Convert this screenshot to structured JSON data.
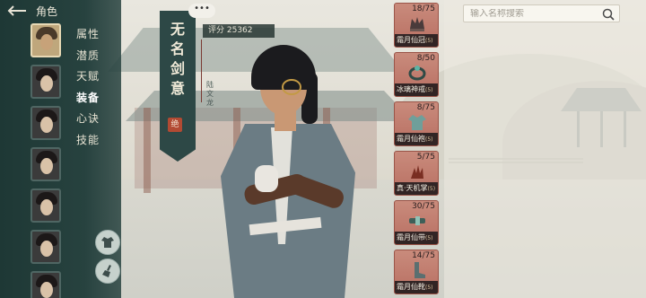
{
  "header": {
    "title": "角色"
  },
  "sidebar": {
    "portraits": [
      {
        "id": "hero-1",
        "active": true
      },
      {
        "id": "hero-2",
        "active": false
      },
      {
        "id": "hero-3",
        "active": false
      },
      {
        "id": "hero-4",
        "active": false
      },
      {
        "id": "hero-5",
        "active": false
      },
      {
        "id": "hero-6",
        "active": false
      },
      {
        "id": "hero-7",
        "active": false
      }
    ],
    "menu": [
      {
        "label": "属性",
        "active": false
      },
      {
        "label": "潜质",
        "active": false
      },
      {
        "label": "天赋",
        "active": false
      },
      {
        "label": "装备",
        "active": true
      },
      {
        "label": "心诀",
        "active": false
      },
      {
        "label": "技能",
        "active": false
      }
    ],
    "buttons": [
      {
        "icon": "robe-icon"
      },
      {
        "icon": "broom-icon"
      }
    ]
  },
  "banner": {
    "title_chars": [
      "无",
      "名",
      "剑",
      "意"
    ],
    "seal": "绝",
    "subtitle": "陆文龙"
  },
  "chat": {
    "label": "•••"
  },
  "score": {
    "label": "评分",
    "value": "25362",
    "text": "评分 25362"
  },
  "equipment": [
    {
      "count": "18/75",
      "name": "霜月仙冠",
      "grade": "(5)",
      "icon": "crown-icon"
    },
    {
      "count": "8/50",
      "name": "冰璃神戒",
      "grade": "(5)",
      "icon": "ring-icon"
    },
    {
      "count": "8/75",
      "name": "霜月仙袍",
      "grade": "(5)",
      "icon": "robe-icon"
    },
    {
      "count": "5/75",
      "name": "真·天机掌",
      "grade": "(5)",
      "icon": "claw-icon"
    },
    {
      "count": "30/75",
      "name": "霜月仙带",
      "grade": "(5)",
      "icon": "belt-icon"
    },
    {
      "count": "14/75",
      "name": "霜月仙靴",
      "grade": "(5)",
      "icon": "boots-icon"
    }
  ],
  "search": {
    "placeholder": "输入名称搜索",
    "value": ""
  },
  "colors": {
    "sidebar": "#27423f",
    "slot": "#c98b7c",
    "banner": "#2d4846",
    "seal": "#b24a33"
  }
}
